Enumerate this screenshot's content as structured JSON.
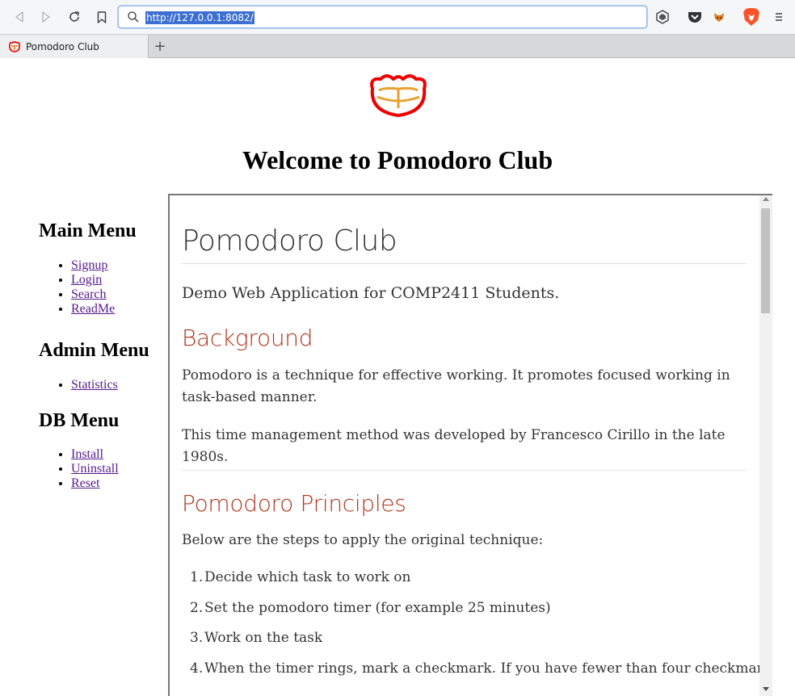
{
  "browser": {
    "url": "http://127.0.0.1:8082/",
    "tab_title": "Pomodoro Club",
    "new_tab_label": "+"
  },
  "page": {
    "welcome": "Welcome to Pomodoro Club"
  },
  "sidebar": {
    "main_menu": {
      "title": "Main Menu",
      "items": [
        "Signup",
        "Login",
        "Search",
        "ReadMe"
      ]
    },
    "admin_menu": {
      "title": "Admin Menu",
      "items": [
        "Statistics"
      ]
    },
    "db_menu": {
      "title": "DB Menu",
      "items": [
        "Install",
        "Uninstall",
        "Reset"
      ]
    }
  },
  "readme": {
    "title": "Pomodoro Club",
    "subtitle": "Demo Web Application for COMP2411 Students.",
    "background_heading": "Background",
    "background_p1": "Pomodoro is a technique for effective working. It promotes focused working in task-based manner.",
    "background_p2": "This time management method was developed by Francesco Cirillo in the late 1980s.",
    "principles_heading": "Pomodoro Principles",
    "principles_intro": "Below are the steps to apply the original technique:",
    "steps": [
      {
        "num": "1.",
        "text": "Decide which task to work on"
      },
      {
        "num": "2.",
        "text": "Set the pomodoro timer (for example 25 minutes)"
      },
      {
        "num": "3.",
        "text": "Work on the task"
      },
      {
        "num": "4.",
        "text": "When the timer rings, mark a checkmark. If you have fewer than four checkmarks,"
      }
    ]
  },
  "colors": {
    "link": "#551a8b",
    "heading_red": "#b1361e",
    "url_highlight": "#3d6fd1"
  }
}
